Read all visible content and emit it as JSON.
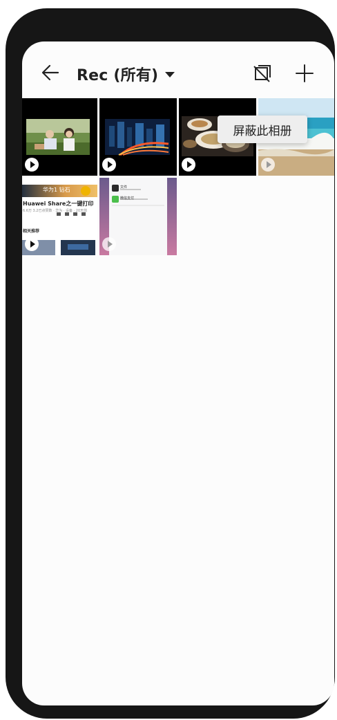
{
  "app": {
    "title": "Rec (所有)"
  },
  "toolbar": {
    "back_icon": "arrow-left-icon",
    "dropdown_icon": "caret-down-icon",
    "hide_icon": "album-hidden-icon",
    "add_icon": "plus-icon"
  },
  "popup_menu": {
    "item_label": "屏蔽此相册"
  },
  "thumbnails": [
    {
      "id": 1,
      "kind": "video",
      "scene": "family outdoors"
    },
    {
      "id": 2,
      "kind": "video",
      "scene": "city night traffic"
    },
    {
      "id": 3,
      "kind": "video",
      "scene": "food dishes"
    },
    {
      "id": 4,
      "kind": "video",
      "scene": "beach waves"
    },
    {
      "id": 5,
      "kind": "video",
      "scene": "article screenshot"
    },
    {
      "id": 6,
      "kind": "video",
      "scene": "chat list screenshot"
    }
  ],
  "thumb5": {
    "banner_text": "华为1 钻石",
    "title": "Huawei Share之一键打印",
    "meta": "6.6万  3.2已点赞数 · 华为 · 设备 · 20天前",
    "section": "相关推荐"
  },
  "thumb6": {
    "items": [
      "文件",
      "微信支付"
    ]
  },
  "colors": {
    "frame": "#161616",
    "screen_bg": "#fcfcfc",
    "popup_bg": "#eeeeee",
    "text": "#222222"
  }
}
